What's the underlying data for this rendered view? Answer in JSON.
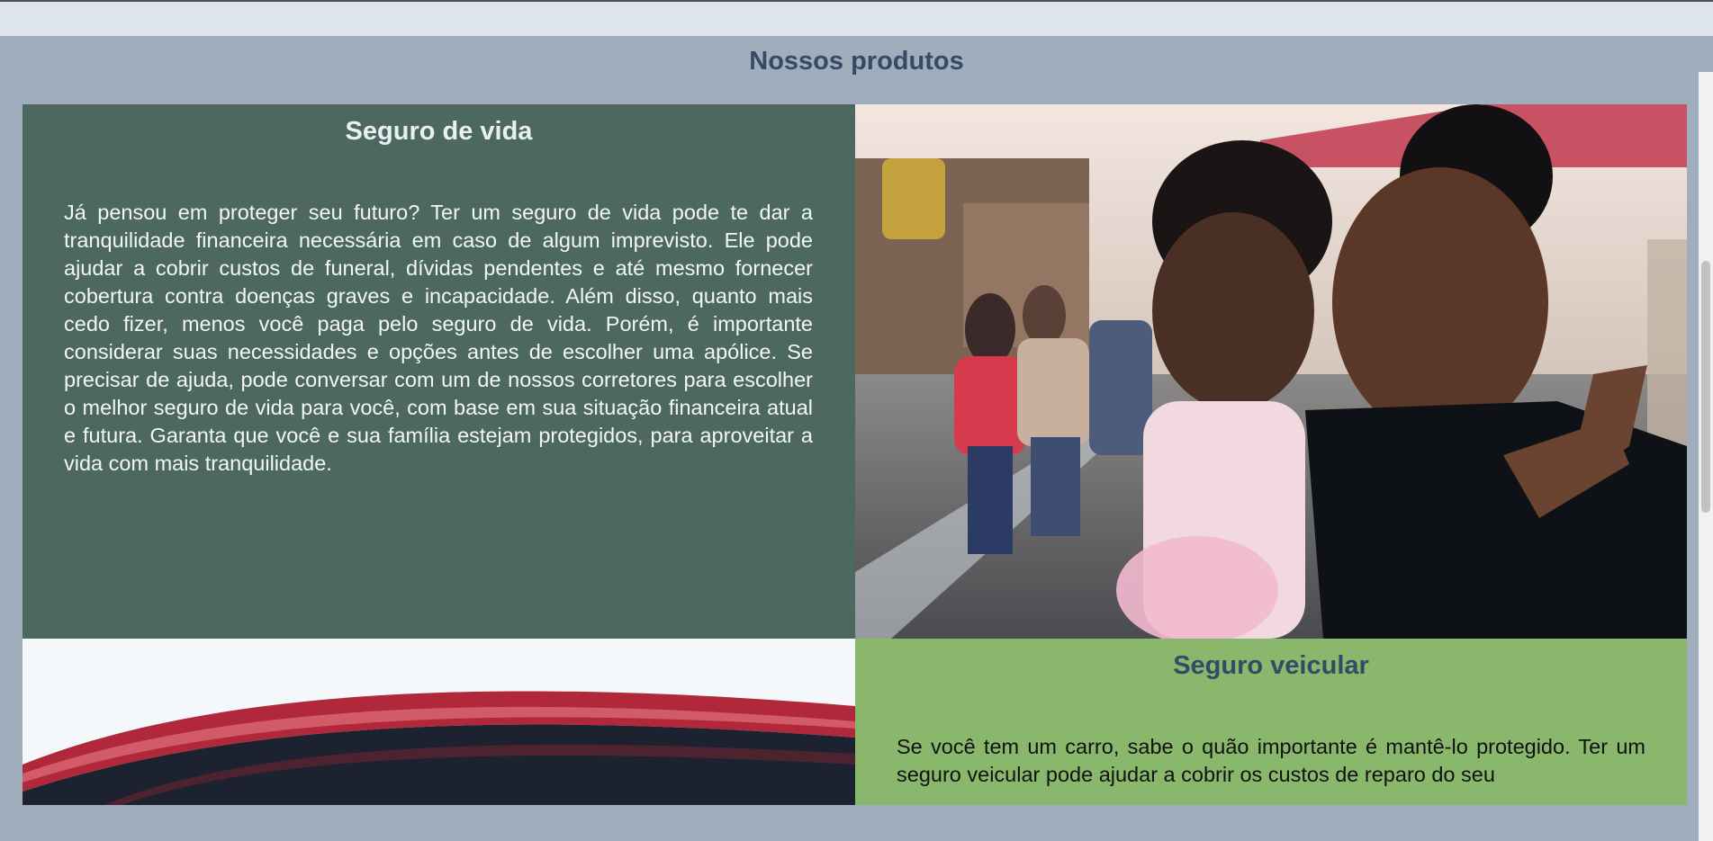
{
  "products": {
    "title": "Nossos produtos",
    "life": {
      "title": "Seguro de vida",
      "text": "Já pensou em proteger seu futuro? Ter um seguro de vida pode te dar a tranquilidade financeira necessária em caso de algum imprevisto. Ele pode ajudar a cobrir custos de funeral, dívidas pendentes e até mesmo fornecer cobertura contra doenças graves e incapacidade. Além disso, quanto mais cedo fizer, menos você paga pelo seguro de vida. Porém, é importante considerar suas necessidades e opções antes de escolher uma apólice. Se precisar de ajuda, pode conversar com um de nossos corretores para escolher o melhor seguro de vida para você, com base em sua situação financeira atual e futura. Garanta que você e sua família estejam protegidos, para aproveitar a vida com mais tranquilidade.",
      "image": "mother-kissing-daughter-photo"
    },
    "vehicle": {
      "title": "Seguro veicular",
      "text": "Se você tem um carro, sabe o quão importante é mantê-lo protegido. Ter um seguro veicular pode ajudar a cobrir os custos de reparo do seu",
      "image": "red-car-roof-photo"
    }
  },
  "colors": {
    "page_bg": "#a0adbc",
    "top_strip": "#dee4ee",
    "title": "#344a66",
    "life_card": "#4c685f",
    "vehicle_card": "#89b86c"
  }
}
